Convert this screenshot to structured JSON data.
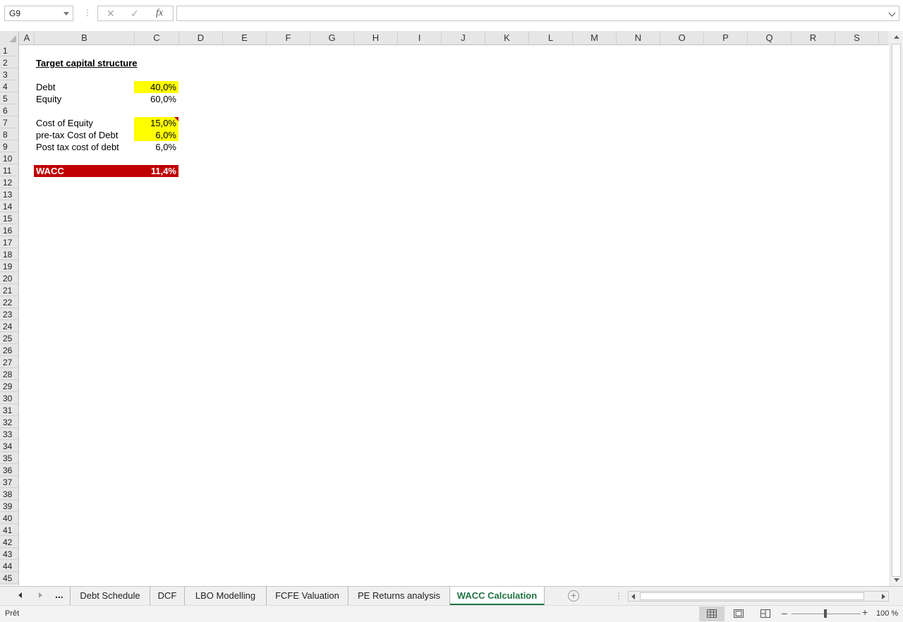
{
  "formula_bar": {
    "name_box": "G9",
    "cancel_icon": "✕",
    "enter_icon": "✓",
    "fx_label": "fx",
    "formula_value": ""
  },
  "columns": [
    "A",
    "B",
    "C",
    "D",
    "E",
    "F",
    "G",
    "H",
    "I",
    "J",
    "K",
    "L",
    "M",
    "N",
    "O",
    "P",
    "Q",
    "R",
    "S"
  ],
  "rows": [
    "1",
    "2",
    "3",
    "4",
    "5",
    "6",
    "7",
    "8",
    "9",
    "10",
    "11",
    "12",
    "13",
    "14",
    "15",
    "16",
    "17",
    "18",
    "19",
    "20",
    "21",
    "22",
    "23",
    "24",
    "25",
    "26",
    "27",
    "28",
    "29",
    "30",
    "31",
    "32",
    "33",
    "34",
    "35",
    "36",
    "37",
    "38",
    "39",
    "40",
    "41",
    "42",
    "43",
    "44",
    "45"
  ],
  "sheet": {
    "title": "Target capital structure",
    "debt_label": "Debt",
    "debt_value": "40,0%",
    "equity_label": "Equity",
    "equity_value": "60,0%",
    "coe_label": "Cost of Equity",
    "coe_value": "15,0%",
    "pretax_cod_label": "pre-tax Cost of Debt",
    "pretax_cod_value": "6,0%",
    "posttax_cod_label": "Post tax cost of debt",
    "posttax_cod_value": "6,0%",
    "wacc_label": "WACC",
    "wacc_value": "11,4%",
    "input_color": "#ffff00",
    "highlight_color": "#c00000"
  },
  "tabs": {
    "more": "...",
    "items": [
      "Debt Schedule",
      "DCF",
      "LBO Modelling",
      "FCFE Valuation",
      "PE Returns analysis",
      "WACC Calculation"
    ],
    "active": "WACC Calculation",
    "accent": "#217346"
  },
  "status": {
    "mode": "Prêt",
    "zoom": "100 %"
  }
}
